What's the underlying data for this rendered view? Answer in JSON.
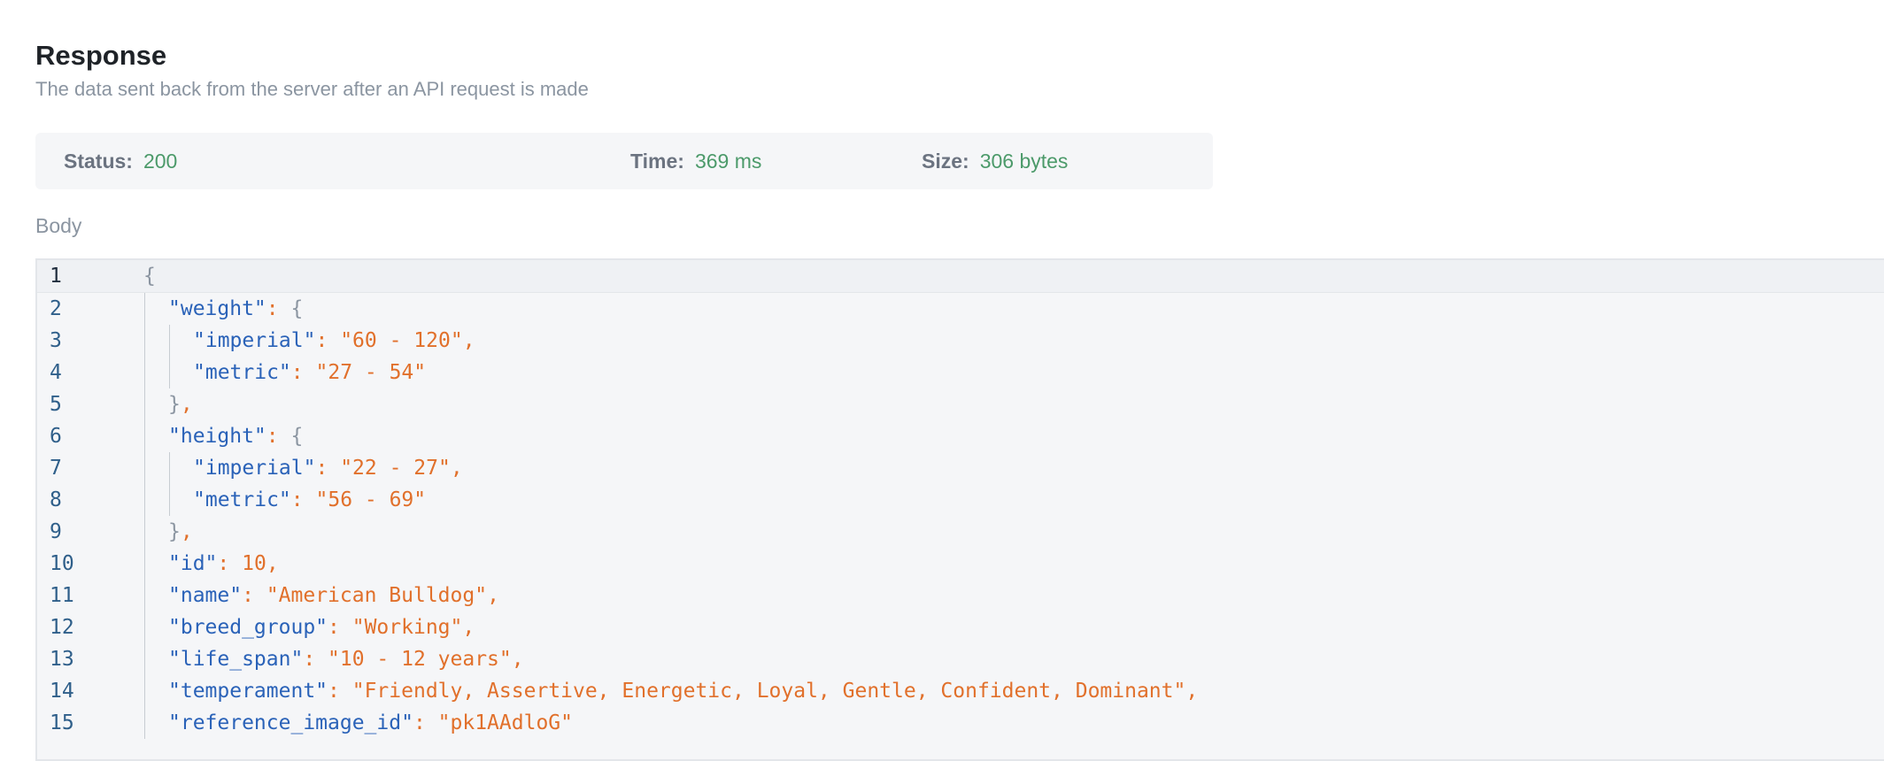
{
  "response": {
    "title": "Response",
    "subtitle": "The data sent back from the server after an API request is made"
  },
  "meta": {
    "status_label": "Status:",
    "status_value": "200",
    "time_label": "Time:",
    "time_value": "369 ms",
    "size_label": "Size:",
    "size_value": "306 bytes"
  },
  "body": {
    "label": "Body",
    "lines": [
      {
        "num": "1",
        "text": "{"
      },
      {
        "num": "2",
        "text": "\"weight\": {"
      },
      {
        "num": "3",
        "text": "\"imperial\": \"60 - 120\","
      },
      {
        "num": "4",
        "text": "\"metric\": \"27 - 54\""
      },
      {
        "num": "5",
        "text": "},"
      },
      {
        "num": "6",
        "text": "\"height\": {"
      },
      {
        "num": "7",
        "text": "\"imperial\": \"22 - 27\","
      },
      {
        "num": "8",
        "text": "\"metric\": \"56 - 69\""
      },
      {
        "num": "9",
        "text": "},"
      },
      {
        "num": "10",
        "text": "\"id\": 10,"
      },
      {
        "num": "11",
        "text": "\"name\": \"American Bulldog\","
      },
      {
        "num": "12",
        "text": "\"breed_group\": \"Working\","
      },
      {
        "num": "13",
        "text": "\"life_span\": \"10 - 12 years\","
      },
      {
        "num": "14",
        "text": "\"temperament\": \"Friendly, Assertive, Energetic, Loyal, Gentle, Confident, Dominant\","
      },
      {
        "num": "15",
        "text": "\"reference_image_id\": \"pk1AAdloG\""
      }
    ]
  },
  "colors": {
    "key": "#2a62b8",
    "string": "#e1702b",
    "punctuation": "#8b95a1",
    "meta_value": "#4c9a6a"
  }
}
